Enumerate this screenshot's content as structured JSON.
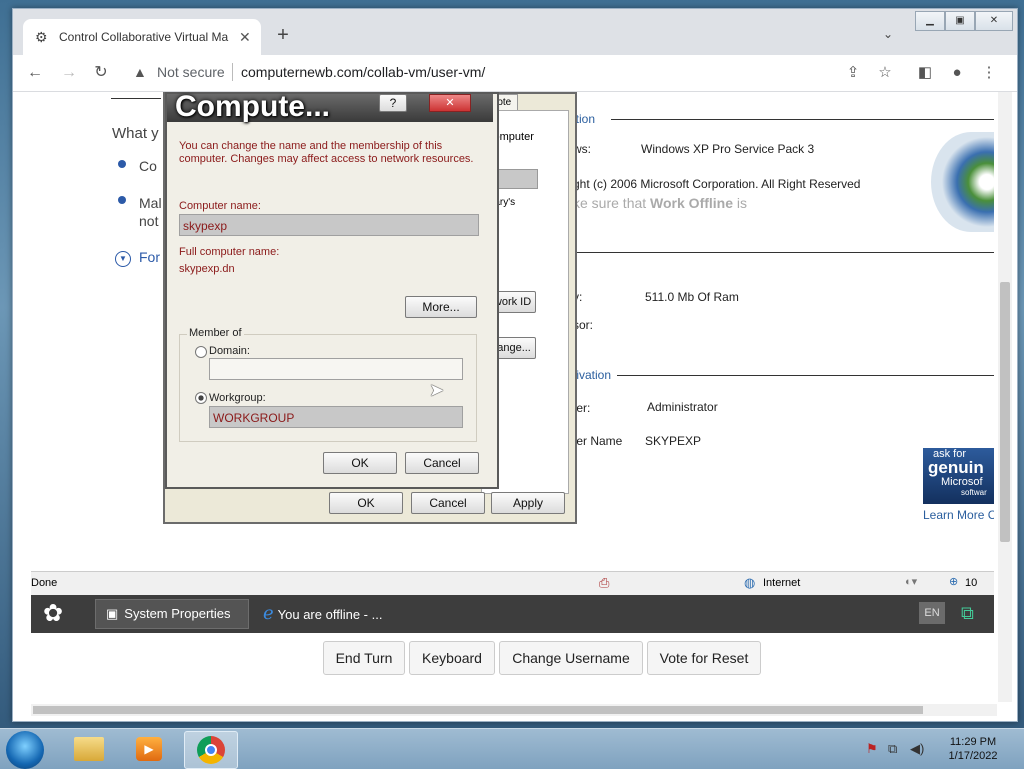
{
  "browser": {
    "tab_title": "Control Collaborative Virtual Ma",
    "new_tab": "+",
    "not_secure": "Not secure",
    "url": "computernewb.com/collab-vm/user-vm/"
  },
  "system_properties": {
    "bg_line_what": "What y",
    "bg_item1": "Co",
    "bg_item2a": "Mal",
    "bg_item2b": "not",
    "bg_item3": "For",
    "tab_remote": "mote",
    "computer_desc": "computer",
    "marys": "Mary's",
    "network_id_btn": "twork ID",
    "change_btn": "hange...",
    "section_edition": "ition",
    "windows_label": "ws:",
    "windows_value": "Windows XP Pro Service Pack 3",
    "copyright_prefix": "ght (c) 2006 Microsoft Corporation. All Right Reserved",
    "offline_text_a": "ke sure that ",
    "offline_text_bold": "Work Offline",
    "offline_text_b": " is",
    "memory_label": "y:",
    "memory_value": "511.0 Mb Of Ram",
    "processor_label": "sor:",
    "section_activation": "tivation",
    "user_label": "ter:",
    "user_value": "Administrator",
    "computer_name_label": "ter Name",
    "computer_name_value": "SKYPEXP",
    "genuine_line1": "ask for",
    "genuine_line2": "genuin",
    "genuine_line3": "Microsof",
    "genuine_line4": "softwar",
    "learn_more": "Learn More C",
    "ok": "OK",
    "cancel": "Cancel",
    "apply": "Apply"
  },
  "dialog": {
    "title": "Compute...",
    "help": "?",
    "close": "✕",
    "intro": "You can change the name and the membership of this computer. Changes may affect access to network resources.",
    "computer_name_label": "Computer name:",
    "computer_name_value": "skypexp",
    "full_name_label": "Full computer name:",
    "full_name_value": "skypexp.dn",
    "more_btn": "More...",
    "member_of": "Member of",
    "domain_label": "Domain:",
    "domain_value": "",
    "workgroup_label": "Workgroup:",
    "workgroup_value": "WORKGROUP",
    "ok": "OK",
    "cancel": "Cancel"
  },
  "ie_status": {
    "done": "Done",
    "zone": "Internet",
    "zoom": "10"
  },
  "xp_taskbar": {
    "item1": "System Properties",
    "item2": "You are offline - ...",
    "lang": "EN"
  },
  "controls": {
    "end_turn": "End Turn",
    "keyboard": "Keyboard",
    "change_username": "Change Username",
    "vote_reset": "Vote for Reset"
  },
  "win7": {
    "time": "11:29 PM",
    "date": "1/17/2022"
  }
}
